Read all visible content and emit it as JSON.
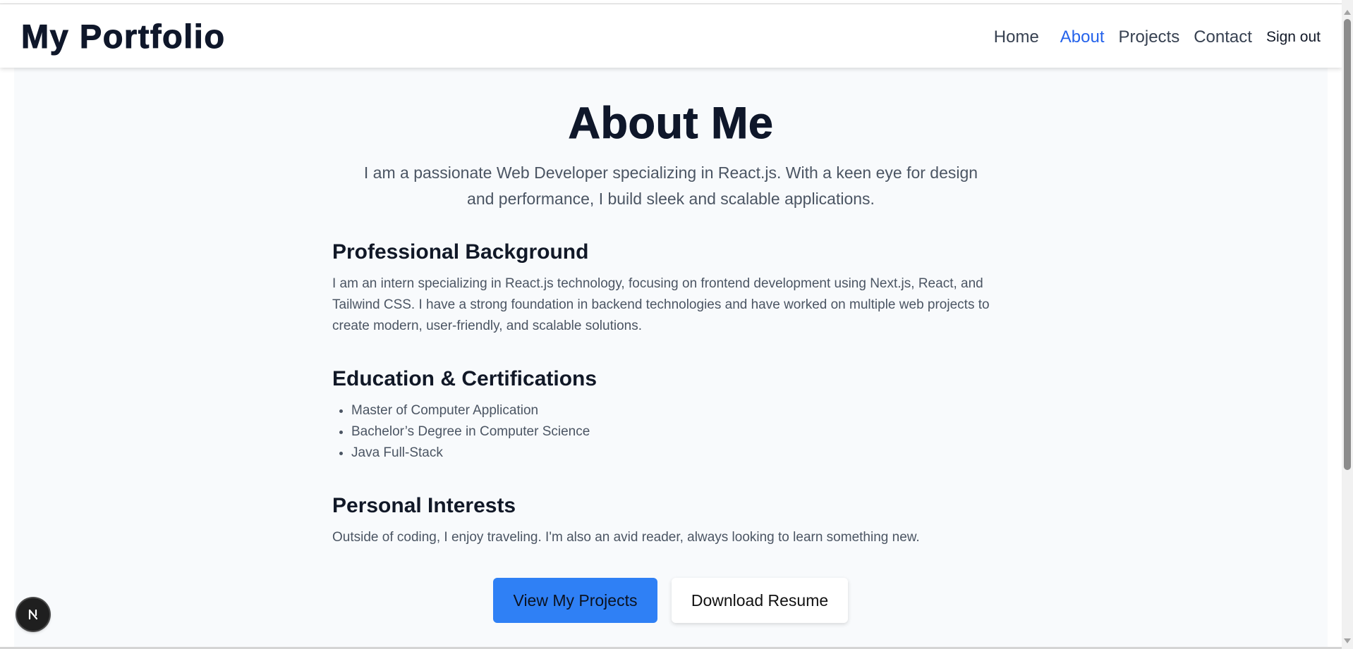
{
  "header": {
    "brand": "My Portfolio",
    "nav": {
      "home": "Home",
      "about": "About",
      "projects": "Projects",
      "contact": "Contact",
      "sign_out": "Sign out"
    },
    "active_link": "About"
  },
  "main": {
    "title": "About Me",
    "intro": "I am a passionate Web Developer specializing in React.js. With a keen eye for design and performance, I build sleek and scalable applications.",
    "background": {
      "heading": "Professional Background",
      "text": "I am an intern specializing in React.js technology, focusing on frontend development using Next.js, React, and Tailwind CSS. I have a strong foundation in backend technologies and have worked on multiple web projects to create modern, user-friendly, and scalable solutions."
    },
    "education": {
      "heading": "Education & Certifications",
      "items": [
        "Master of Computer Application",
        "Bachelor’s Degree in Computer Science",
        "Java Full-Stack"
      ]
    },
    "interests": {
      "heading": "Personal Interests",
      "text": "Outside of coding, I enjoy traveling. I'm also an avid reader, always looking to learn something new."
    },
    "buttons": {
      "primary": "View My Projects",
      "secondary": "Download Resume"
    }
  },
  "dev_badge": {
    "icon": "nextjs-icon"
  },
  "colors": {
    "accent": "#2563eb",
    "primary_button": "#2f80f5",
    "heading": "#0f172a",
    "body_text": "#4b5563",
    "page_background": "#f8fafc"
  }
}
